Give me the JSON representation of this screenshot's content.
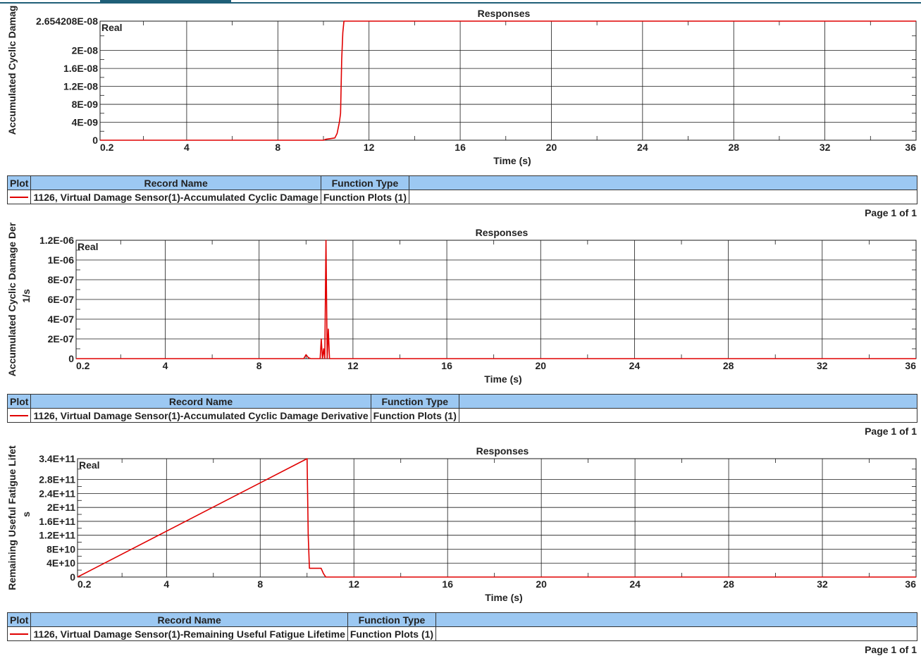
{
  "colors": {
    "series": "#e00000",
    "legend_header": "#9cc8f2",
    "grid": "#1a1a1a",
    "topbar": "#1f5f78"
  },
  "legend_headers": {
    "plot": "Plot",
    "record_name": "Record Name",
    "function_type": "Function Type"
  },
  "page_label": "Page 1 of 1",
  "chart_data": [
    {
      "type": "line",
      "title": "Responses",
      "xlabel": "Time (s)",
      "ylabel": "Accumulated Cyclic Damag",
      "ylabel_unit": "",
      "corner_label": "Real",
      "xlim": [
        0.2,
        36
      ],
      "ylim": [
        0,
        2.654208e-08
      ],
      "xticks": [
        0.2,
        4,
        8,
        12,
        16,
        20,
        24,
        28,
        32,
        36
      ],
      "xtick_labels": [
        "0.2",
        "4",
        "8",
        "12",
        "16",
        "20",
        "24",
        "28",
        "32",
        "36"
      ],
      "yticks": [
        0,
        4e-09,
        8e-09,
        1.2e-08,
        1.6e-08,
        2e-08,
        2.654208e-08
      ],
      "ytick_labels": [
        "0",
        "4E-09",
        "8E-09",
        "1.2E-08",
        "1.6E-08",
        "2E-08",
        "2.654208E-08"
      ],
      "series": [
        {
          "record_name": "1126, Virtual Damage Sensor(1)-Accumulated Cyclic Damage",
          "function_type": "Function Plots (1)",
          "x": [
            0.2,
            9.8,
            10.0,
            10.1,
            10.5,
            10.6,
            10.7,
            10.75,
            10.8,
            10.85,
            10.9,
            11.0,
            36
          ],
          "y": [
            0,
            0,
            0,
            2e-10,
            5e-10,
            1.5e-09,
            4e-09,
            6e-09,
            1.8e-08,
            2.4e-08,
            2.654208e-08,
            2.654208e-08,
            2.654208e-08
          ]
        }
      ]
    },
    {
      "type": "line",
      "title": "Responses",
      "xlabel": "Time (s)",
      "ylabel": "Accumulated Cyclic Damage Der",
      "ylabel_unit": "1/s",
      "corner_label": "Real",
      "xlim": [
        0.2,
        36
      ],
      "ylim": [
        0,
        1.2e-06
      ],
      "xticks": [
        0.2,
        4,
        8,
        12,
        16,
        20,
        24,
        28,
        32,
        36
      ],
      "xtick_labels": [
        "0.2",
        "4",
        "8",
        "12",
        "16",
        "20",
        "24",
        "28",
        "32",
        "36"
      ],
      "yticks": [
        0,
        2e-07,
        4e-07,
        6e-07,
        8e-07,
        1e-06,
        1.2e-06
      ],
      "ytick_labels": [
        "0",
        "2E-07",
        "4E-07",
        "6E-07",
        "8E-07",
        "1E-06",
        "1.2E-06"
      ],
      "series": [
        {
          "record_name": "1126, Virtual Damage Sensor(1)-Accumulated Cyclic Damage Derivative",
          "function_type": "Function Plots (1)",
          "x": [
            0.2,
            9.9,
            10.0,
            10.1,
            10.2,
            10.6,
            10.65,
            10.7,
            10.75,
            10.8,
            10.85,
            10.9,
            10.95,
            11.0,
            36
          ],
          "y": [
            0,
            0,
            4e-08,
            1e-08,
            0,
            0,
            2e-07,
            0,
            1e-07,
            0,
            1.2e-06,
            0,
            3e-07,
            0,
            0
          ]
        }
      ]
    },
    {
      "type": "line",
      "title": "Responses",
      "xlabel": "Time (s)",
      "ylabel": "Remaining Useful Fatigue Lifet",
      "ylabel_unit": "s",
      "corner_label": "Real",
      "xlim": [
        0.2,
        36
      ],
      "ylim": [
        0,
        340000000000.0
      ],
      "xticks": [
        0.2,
        4,
        8,
        12,
        16,
        20,
        24,
        28,
        32,
        36
      ],
      "xtick_labels": [
        "0.2",
        "4",
        "8",
        "12",
        "16",
        "20",
        "24",
        "28",
        "32",
        "36"
      ],
      "yticks": [
        0,
        40000000000.0,
        80000000000.0,
        120000000000.0,
        160000000000.0,
        200000000000.0,
        240000000000.0,
        280000000000.0,
        340000000000.0
      ],
      "ytick_labels": [
        "0",
        "4E+10",
        "8E+10",
        "1.2E+11",
        "1.6E+11",
        "2E+11",
        "2.4E+11",
        "2.8E+11",
        "3.4E+11"
      ],
      "series": [
        {
          "record_name": "1126, Virtual Damage Sensor(1)-Remaining Useful Fatigue Lifetime",
          "function_type": "Function Plots (1)",
          "x": [
            0.2,
            10.0,
            10.05,
            10.1,
            10.6,
            10.7,
            10.8,
            36
          ],
          "y": [
            0,
            340000000000.0,
            120000000000.0,
            25000000000.0,
            25000000000.0,
            10000000000.0,
            0,
            0
          ]
        }
      ]
    }
  ]
}
